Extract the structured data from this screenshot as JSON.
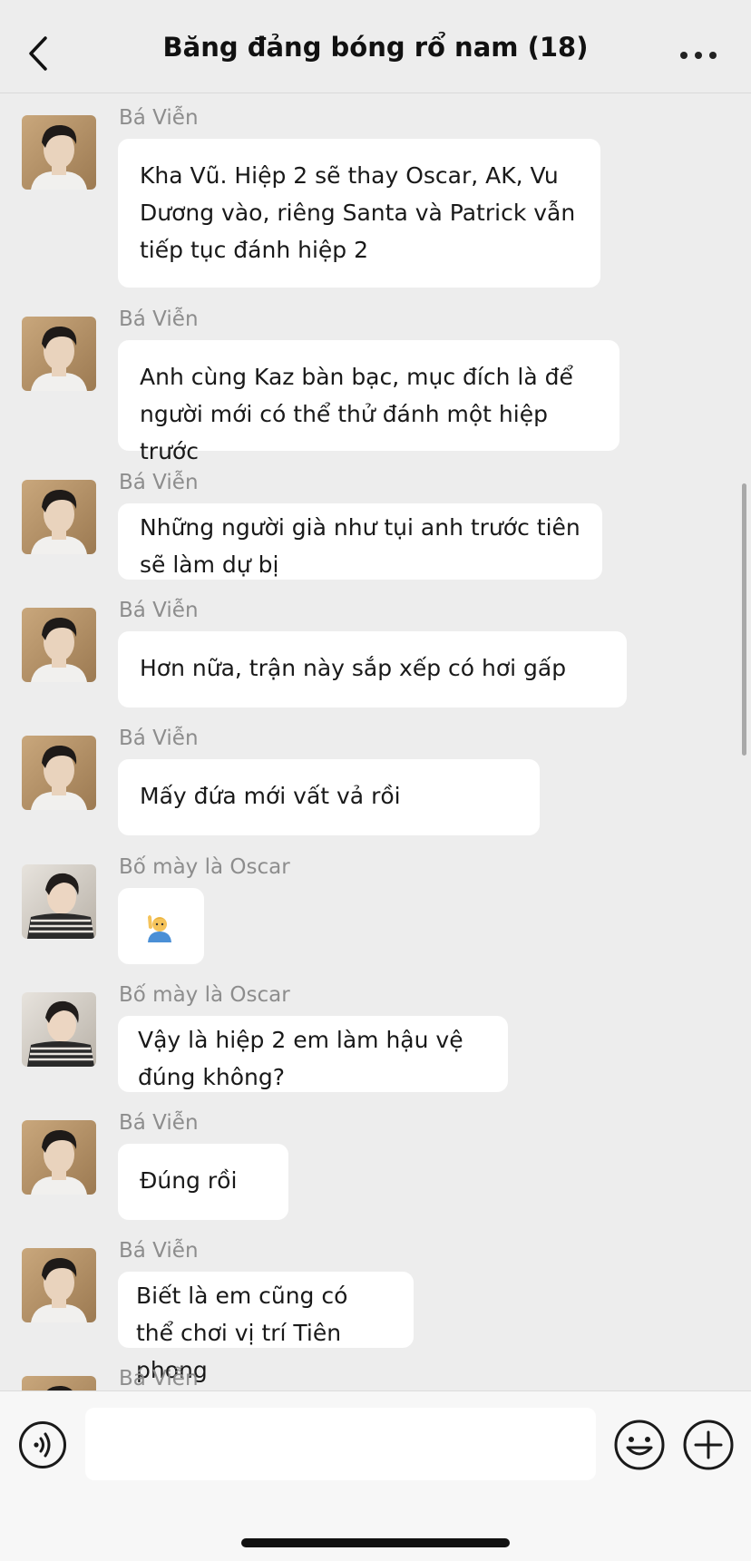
{
  "header": {
    "title": "Băng đảng bóng rổ nam (18)",
    "back_icon": "chevron-left-icon",
    "more_icon": "more-dots-icon"
  },
  "messages": [
    {
      "sender": "Bá Viễn",
      "avatar": "ba-vien",
      "text": "Kha Vũ. Hiệp 2 sẽ thay Oscar, AK, Vu Dương vào, riêng Santa và Patrick vẫn tiếp tục đánh hiệp 2"
    },
    {
      "sender": "Bá Viễn",
      "avatar": "ba-vien",
      "text": "Anh cùng Kaz bàn bạc, mục đích là để người mới có thể thử đánh một hiệp trước"
    },
    {
      "sender": "Bá Viễn",
      "avatar": "ba-vien",
      "text": "Những người già như tụi anh trước tiên sẽ làm dự bị"
    },
    {
      "sender": "Bá Viễn",
      "avatar": "ba-vien",
      "text": "Hơn nữa, trận này sắp xếp có hơi gấp"
    },
    {
      "sender": "Bá Viễn",
      "avatar": "ba-vien",
      "text": "Mấy đứa mới vất vả rồi"
    },
    {
      "sender": "Bố mày là Oscar",
      "avatar": "oscar",
      "text": "",
      "emoji": "raising-hand-emoji"
    },
    {
      "sender": "Bố mày là Oscar",
      "avatar": "oscar",
      "text": "Vậy là hiệp 2 em làm hậu vệ đúng không?"
    },
    {
      "sender": "Bá Viễn",
      "avatar": "ba-vien",
      "text": "Đúng rồi"
    },
    {
      "sender": "Bá Viễn",
      "avatar": "ba-vien",
      "text": "Biết là em cũng có thể chơi vị trí Tiên phong"
    },
    {
      "sender": "Bá Viễn",
      "avatar": "ba-vien",
      "text": ""
    }
  ],
  "input_bar": {
    "voice_icon": "voice-icon",
    "emoji_icon": "emoji-icon",
    "plus_icon": "plus-icon",
    "input_value": ""
  }
}
